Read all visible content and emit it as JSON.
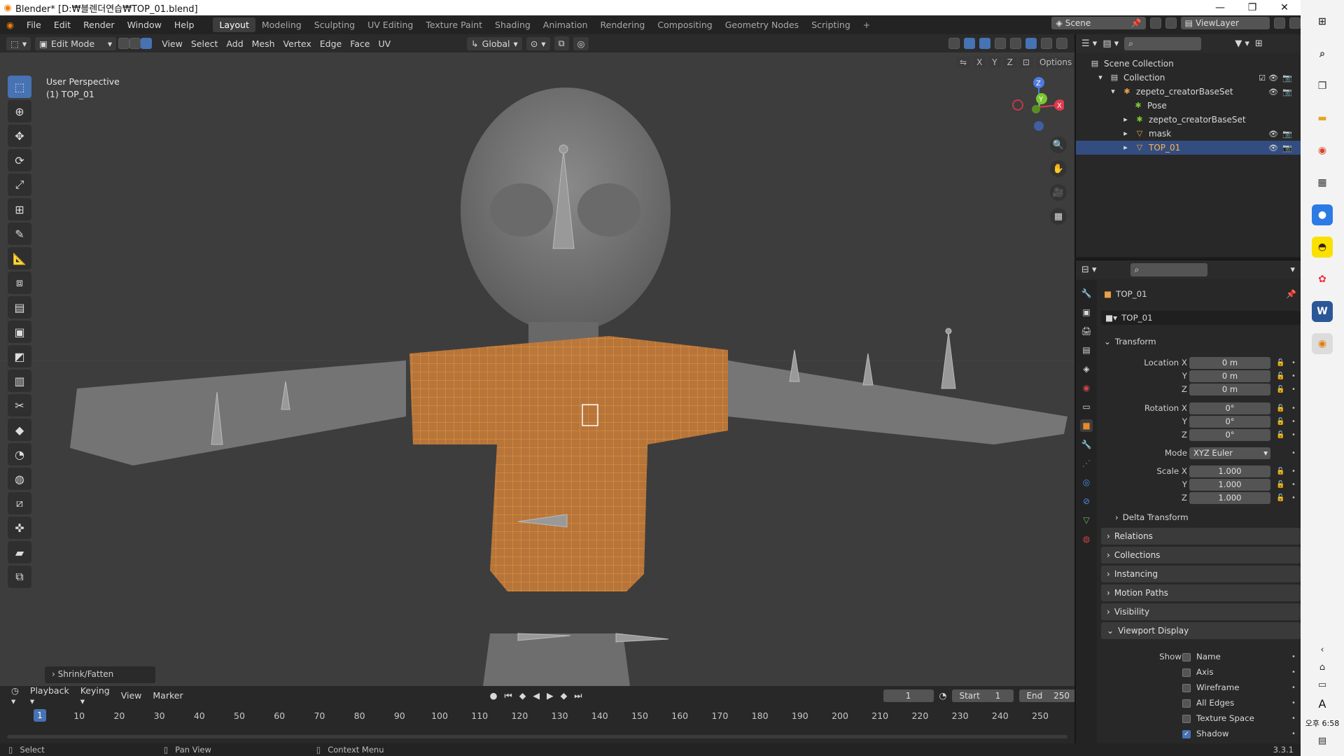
{
  "window": {
    "title": "Blender* [D:₩블렌더연습₩TOP_01.blend]",
    "min": "—",
    "restore": "❐",
    "close": "✕"
  },
  "menu": [
    "File",
    "Edit",
    "Render",
    "Window",
    "Help"
  ],
  "workspaces": [
    "Layout",
    "Modeling",
    "Sculpting",
    "UV Editing",
    "Texture Paint",
    "Shading",
    "Animation",
    "Rendering",
    "Compositing",
    "Geometry Nodes",
    "Scripting",
    "+"
  ],
  "scene": "Scene",
  "view_layer": "ViewLayer",
  "vp_header": {
    "mode": "Edit Mode",
    "menus": [
      "View",
      "Select",
      "Add",
      "Mesh",
      "Vertex",
      "Edge",
      "Face",
      "UV"
    ],
    "orientation": "Global",
    "options": "Options",
    "axes": [
      "X",
      "Y",
      "Z"
    ]
  },
  "vp_info": {
    "line1": "User Perspective",
    "line2": "(1) TOP_01"
  },
  "gizmo": {
    "z": "Z",
    "y": "Y",
    "x": "X"
  },
  "operator_panel": "Shrink/Fatten",
  "timeline": {
    "menus": [
      "Playback",
      "Keying",
      "View",
      "Marker"
    ],
    "current_frame": "1",
    "start_label": "Start",
    "start": "1",
    "end_label": "End",
    "end": "250",
    "ticks": [
      "10",
      "20",
      "30",
      "40",
      "50",
      "60",
      "70",
      "80",
      "90",
      "100",
      "110",
      "120",
      "130",
      "140",
      "150",
      "160",
      "170",
      "180",
      "190",
      "200",
      "210",
      "220",
      "230",
      "240",
      "250"
    ],
    "playhead": "1"
  },
  "statusbar": {
    "select": "Select",
    "pan": "Pan View",
    "context": "Context Menu",
    "version": "3.3.1"
  },
  "outliner": {
    "root": "Scene Collection",
    "collection": "Collection",
    "items": [
      {
        "name": "zepeto_creatorBaseSet",
        "level": 2
      },
      {
        "name": "Pose",
        "level": 3
      },
      {
        "name": "zepeto_creatorBaseSet",
        "level": 3
      },
      {
        "name": "mask",
        "level": 3
      },
      {
        "name": "TOP_01",
        "level": 3
      }
    ]
  },
  "props": {
    "object_name": "TOP_01",
    "datablock": "TOP_01",
    "transform_label": "Transform",
    "location": {
      "label": "Location X",
      "x": "0 m",
      "y": "0 m",
      "z": "0 m"
    },
    "rotation": {
      "label": "Rotation X",
      "x": "0°",
      "y": "0°",
      "z": "0°"
    },
    "mode_label": "Mode",
    "mode": "XYZ Euler",
    "scale": {
      "label": "Scale X",
      "x": "1.000",
      "y": "1.000",
      "z": "1.000"
    },
    "axis_y": "Y",
    "axis_z": "Z",
    "delta": "Delta Transform",
    "sections": [
      "Relations",
      "Collections",
      "Instancing",
      "Motion Paths",
      "Visibility",
      "Viewport Display"
    ],
    "show_label": "Show",
    "show": [
      {
        "label": "Name",
        "checked": false
      },
      {
        "label": "Axis",
        "checked": false
      },
      {
        "label": "Wireframe",
        "checked": false
      },
      {
        "label": "All Edges",
        "checked": false
      },
      {
        "label": "Texture Space",
        "checked": false
      },
      {
        "label": "Shadow",
        "checked": true
      }
    ]
  },
  "taskbar": {
    "time": "오후 6:58",
    "ime": "A"
  }
}
